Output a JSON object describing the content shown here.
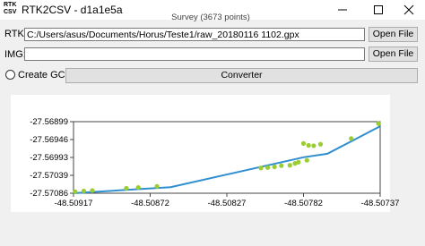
{
  "window": {
    "icon_text": [
      "RTK",
      "CSV"
    ],
    "title": "RTK2CSV - d1a1e5a",
    "controls": [
      "minimize",
      "maximize",
      "close"
    ]
  },
  "rtk": {
    "label": "RTK:",
    "value": "C:/Users/asus/Documents/Horus/Teste1/raw_20180116 1102.gpx",
    "button": "Open File"
  },
  "img": {
    "label": "IMG:",
    "value": "",
    "button": "Open File"
  },
  "gcp": {
    "label": "Create GCP",
    "checked": false
  },
  "convert_button": "Converter",
  "chart_data": {
    "type": "scatter",
    "title": "Survey (3673 points)",
    "x_ticks": [
      "-48.50917",
      "-48.50872",
      "-48.50827",
      "-48.50782",
      "-48.50737"
    ],
    "y_ticks": [
      "-27.56899",
      "-27.56946",
      "-27.56993",
      "-27.57039",
      "-27.57086"
    ],
    "xlim": [
      -48.50917,
      -48.50737
    ],
    "ylim": [
      -27.57086,
      -27.56899
    ],
    "colors": {
      "line": "#2f8fd0",
      "points": "#9acd32"
    },
    "line_series": [
      {
        "x": -48.50917,
        "y": -27.57086
      },
      {
        "x": -48.5086,
        "y": -27.5707
      },
      {
        "x": -48.50782,
        "y": -27.56992
      },
      {
        "x": -48.50768,
        "y": -27.56983
      },
      {
        "x": -48.50737,
        "y": -27.56911
      }
    ],
    "points": [
      {
        "x": -48.50916,
        "y": -27.57082
      },
      {
        "x": -48.50911,
        "y": -27.5708
      },
      {
        "x": -48.50906,
        "y": -27.57079
      },
      {
        "x": -48.50886,
        "y": -27.57073
      },
      {
        "x": -48.50879,
        "y": -27.57071
      },
      {
        "x": -48.50868,
        "y": -27.57068
      },
      {
        "x": -48.50807,
        "y": -27.5702
      },
      {
        "x": -48.50803,
        "y": -27.57019
      },
      {
        "x": -48.50799,
        "y": -27.57017
      },
      {
        "x": -48.50795,
        "y": -27.57014
      },
      {
        "x": -48.5079,
        "y": -27.57013
      },
      {
        "x": -48.50787,
        "y": -27.57008
      },
      {
        "x": -48.50785,
        "y": -27.57005
      },
      {
        "x": -48.5078,
        "y": -27.57
      },
      {
        "x": -48.50782,
        "y": -27.56956
      },
      {
        "x": -48.50779,
        "y": -27.56961
      },
      {
        "x": -48.50776,
        "y": -27.56962
      },
      {
        "x": -48.50772,
        "y": -27.56958
      },
      {
        "x": -48.50754,
        "y": -27.56943
      },
      {
        "x": -48.50738,
        "y": -27.56904
      }
    ]
  }
}
